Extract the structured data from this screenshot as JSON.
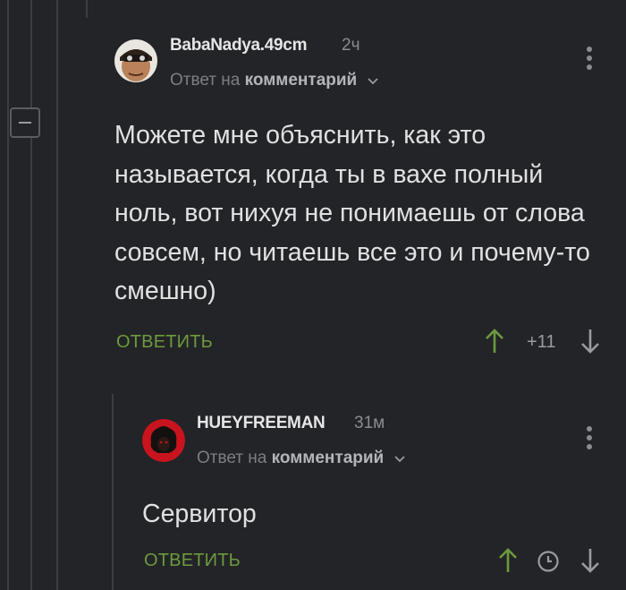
{
  "comment1": {
    "username": "BabaNadya.49cm",
    "time": "2ч",
    "reply_prefix": "Ответ на",
    "reply_target": "комментарий",
    "text": "Можете мне объяснить, как это называется, когда ты в вахе полный ноль, вот нихуя не понимаешь от слова совсем, но читаешь все это и почему-то смешно)",
    "reply_label": "ОТВЕТИТЬ",
    "rating": "+11"
  },
  "comment2": {
    "username": "HUEYFREEMAN",
    "time": "31м",
    "reply_prefix": "Ответ на",
    "reply_target": "комментарий",
    "text": "Сервитор",
    "reply_label": "ОТВЕТИТЬ"
  },
  "colors": {
    "background": "#232427",
    "accent_green": "#6d9a3e",
    "thread_line": "#3c3d40"
  },
  "icons": [
    "minus-icon",
    "chevron-down-icon",
    "menu-dots-icon",
    "upvote-arrow-icon",
    "downvote-arrow-icon",
    "clock-icon"
  ]
}
